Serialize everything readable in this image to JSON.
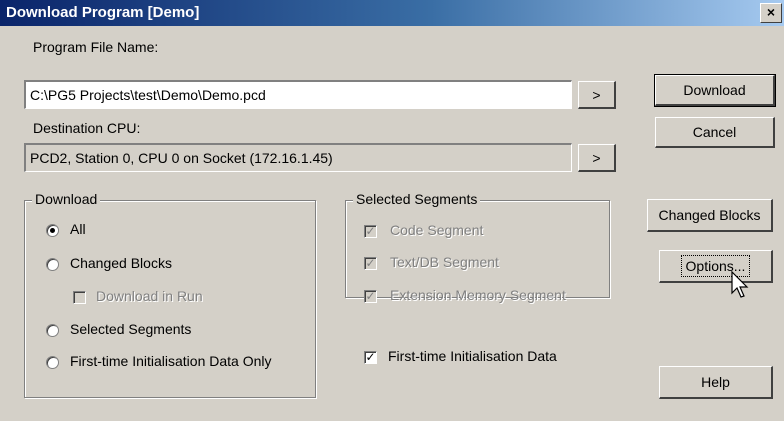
{
  "window": {
    "title": "Download Program [Demo]",
    "close_glyph": "×"
  },
  "program_file": {
    "label": "Program File Name:",
    "value": "C:\\PG5 Projects\\test\\Demo\\Demo.pcd",
    "browse_label": ">"
  },
  "destination": {
    "label": "Destination CPU:",
    "value": "PCD2, Station 0, CPU 0 on Socket (172.16.1.45)",
    "browse_label": ">"
  },
  "buttons": {
    "download": "Download",
    "cancel": "Cancel",
    "changed_blocks": "Changed Blocks",
    "options": "Options...",
    "help": "Help"
  },
  "download_group": {
    "title": "Download",
    "options": [
      {
        "label": "All",
        "selected": true
      },
      {
        "label": "Changed Blocks",
        "selected": false
      },
      {
        "label": "Download in Run",
        "checked": false,
        "disabled": true
      },
      {
        "label": "Selected Segments",
        "selected": false
      },
      {
        "label": "First-time Initialisation Data Only",
        "selected": false
      }
    ]
  },
  "segments_group": {
    "title": "Selected Segments",
    "items": [
      {
        "label": "Code Segment",
        "checked": true,
        "disabled": true
      },
      {
        "label": "Text/DB Segment",
        "checked": true,
        "disabled": true
      },
      {
        "label": "Extension Memory Segment",
        "checked": true,
        "disabled": true
      }
    ]
  },
  "init_data": {
    "label": "First-time Initialisation Data",
    "checked": true
  },
  "colors": {
    "titlebar_start": "#0a246a",
    "titlebar_end": "#a6caf0",
    "face": "#d4d0c8"
  }
}
